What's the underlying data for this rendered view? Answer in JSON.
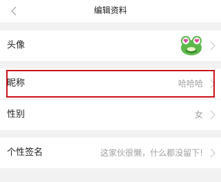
{
  "navbar": {
    "title": "编辑资料",
    "back_icon": "chevron-left-icon"
  },
  "rows": [
    {
      "label": "头像",
      "value": "",
      "icon": "frog-avatar"
    },
    {
      "label": "昵称",
      "value": "哈哈哈",
      "highlighted": true
    },
    {
      "label": "性别",
      "value": "女"
    },
    {
      "label": "个性签名",
      "value": "这家伙很懒，什么都没留下!"
    }
  ],
  "colors": {
    "background": "#f2f2f2",
    "row_background": "#ffffff",
    "value_text": "#a0a0a0",
    "highlight_border": "#c8121a",
    "avatar_green": "#5cb84a",
    "avatar_eye_pink": "#e0509a"
  }
}
